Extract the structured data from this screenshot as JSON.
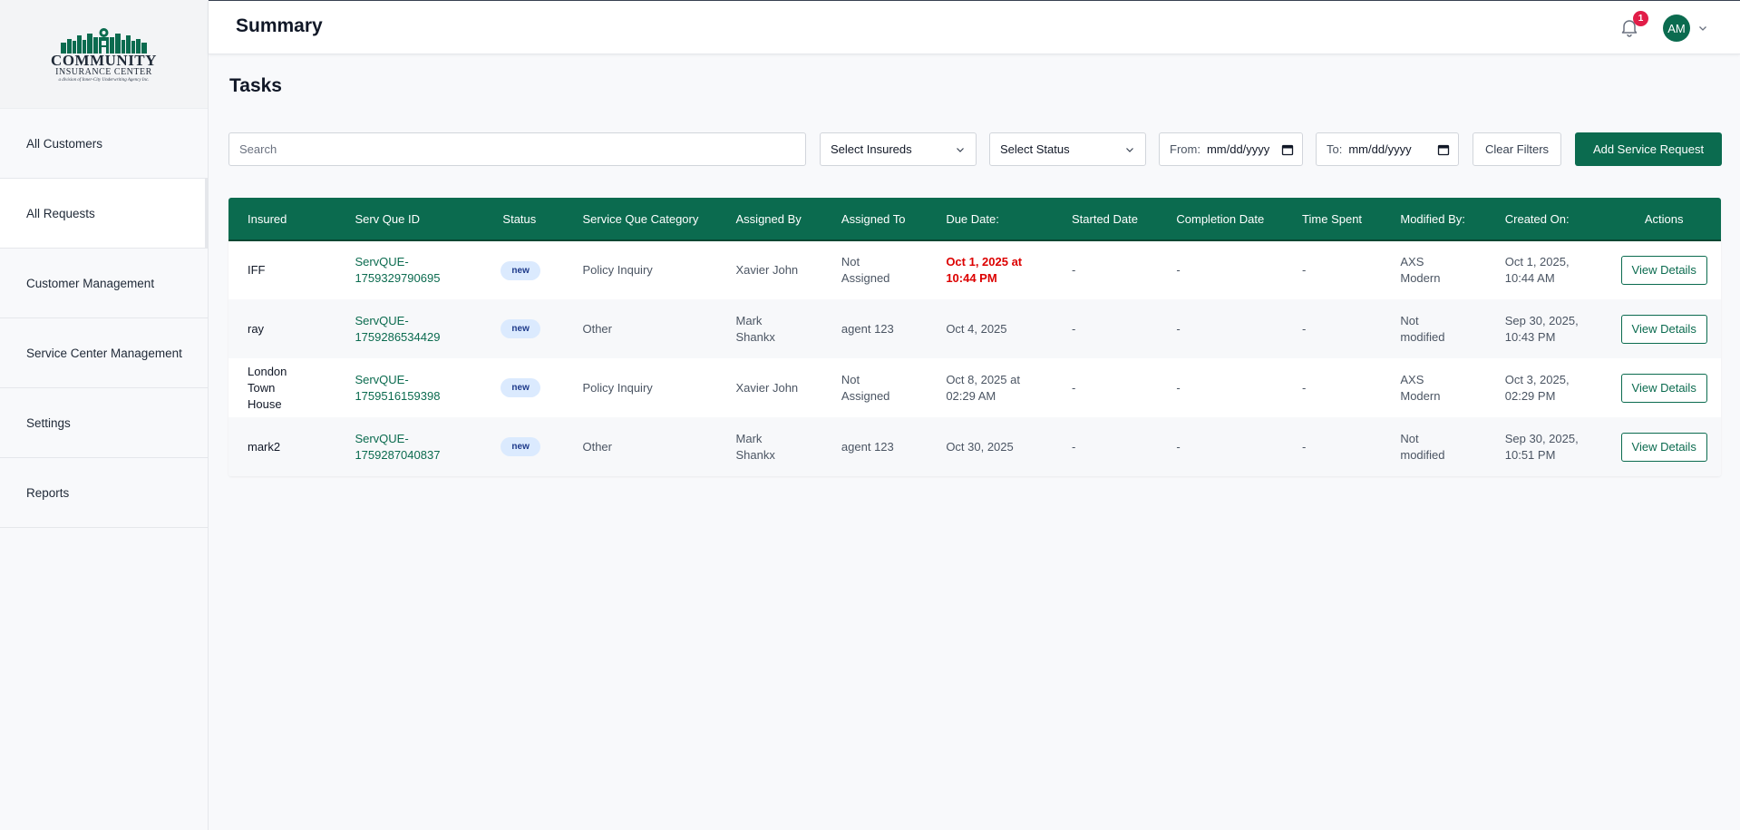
{
  "brand": {
    "name_line1": "COMMUNITY",
    "name_line2": "INSURANCE CENTER",
    "tagline": "a division of Inner-City Underwriting Agency Inc.",
    "color": "#0b6b4f"
  },
  "sidebar": {
    "items": [
      {
        "label": "All Customers",
        "active": false
      },
      {
        "label": "All Requests",
        "active": true
      },
      {
        "label": "Customer Management",
        "active": false
      },
      {
        "label": "Service Center Management",
        "active": false
      },
      {
        "label": "Settings",
        "active": false
      },
      {
        "label": "Reports",
        "active": false
      }
    ]
  },
  "header": {
    "title": "Summary",
    "notifications_icon": "bell-icon",
    "notification_count": "1",
    "user_initials": "AM"
  },
  "main": {
    "title": "Tasks",
    "filters": {
      "search_placeholder": "Search",
      "insureds_select": "Select Insureds",
      "status_select": "Select Status",
      "from_label": "From:",
      "from_value": "mm/dd/yyyy",
      "to_label": "To:",
      "to_value": "mm/dd/yyyy",
      "clear_label": "Clear Filters",
      "add_label": "Add Service Request"
    },
    "table": {
      "columns": [
        "Insured",
        "Serv Que ID",
        "Status",
        "Service Que Category",
        "Assigned By",
        "Assigned To",
        "Due Date:",
        "Started Date",
        "Completion Date",
        "Time Spent",
        "Modified By:",
        "Created On:",
        "Actions"
      ],
      "rows": [
        {
          "insured": "IFF",
          "id_1": "ServQUE-",
          "id_2": "1759329790695",
          "status": "new",
          "category": "Policy Inquiry",
          "assigned_by_1": "Xavier John",
          "assigned_by_2": "",
          "assigned_to_1": "Not",
          "assigned_to_2": "Assigned",
          "due_1": "Oct 1, 2025 at",
          "due_2": "10:44 PM",
          "due_overdue": true,
          "started": "-",
          "completed": "-",
          "time_spent": "-",
          "modified_1": "AXS",
          "modified_2": "Modern",
          "created_1": "Oct 1, 2025,",
          "created_2": "10:44 AM",
          "action": "View Details"
        },
        {
          "insured": "ray",
          "id_1": "ServQUE-",
          "id_2": "1759286534429",
          "status": "new",
          "category": "Other",
          "assigned_by_1": "Mark",
          "assigned_by_2": "Shankx",
          "assigned_to_1": "agent 123",
          "assigned_to_2": "",
          "due_1": "Oct 4, 2025",
          "due_2": "",
          "due_overdue": false,
          "started": "-",
          "completed": "-",
          "time_spent": "-",
          "modified_1": "Not",
          "modified_2": "modified",
          "created_1": "Sep 30, 2025,",
          "created_2": "10:43 PM",
          "action": "View Details"
        },
        {
          "insured": "London Town House",
          "id_1": "ServQUE-",
          "id_2": "1759516159398",
          "status": "new",
          "category": "Policy Inquiry",
          "assigned_by_1": "Xavier John",
          "assigned_by_2": "",
          "assigned_to_1": "Not",
          "assigned_to_2": "Assigned",
          "due_1": "Oct 8, 2025 at",
          "due_2": "02:29 AM",
          "due_overdue": false,
          "started": "-",
          "completed": "-",
          "time_spent": "-",
          "modified_1": "AXS",
          "modified_2": "Modern",
          "created_1": "Oct 3, 2025,",
          "created_2": "02:29 PM",
          "action": "View Details"
        },
        {
          "insured": "mark2",
          "id_1": "ServQUE-",
          "id_2": "1759287040837",
          "status": "new",
          "category": "Other",
          "assigned_by_1": "Mark",
          "assigned_by_2": "Shankx",
          "assigned_to_1": "agent 123",
          "assigned_to_2": "",
          "due_1": "Oct 30, 2025",
          "due_2": "",
          "due_overdue": false,
          "started": "-",
          "completed": "-",
          "time_spent": "-",
          "modified_1": "Not",
          "modified_2": "modified",
          "created_1": "Sep 30, 2025,",
          "created_2": "10:51 PM",
          "action": "View Details"
        }
      ]
    }
  },
  "colors": {
    "primary": "#0b6b4f",
    "overdue": "#dc0000",
    "badge_bg": "#dbeafe",
    "notification": "#e11d48"
  }
}
